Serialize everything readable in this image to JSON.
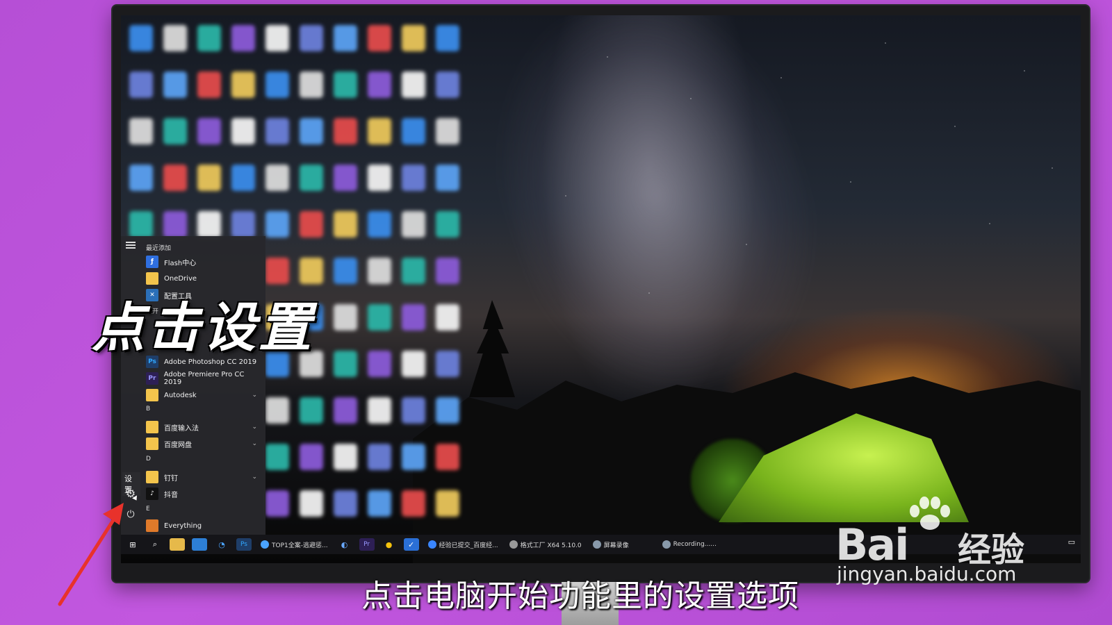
{
  "overlay": {
    "title": "点击设置",
    "subtitle": "点击电脑开始功能里的设置选项"
  },
  "watermark": {
    "brand": "Bai",
    "brand_cn": "经验",
    "url": "jingyan.baidu.com"
  },
  "start_menu": {
    "recent_header": "最近添加",
    "recent_items": [
      {
        "label": "Flash中心",
        "icon": "flash-icon",
        "color": "#2f6fe0"
      },
      {
        "label": "OneDrive",
        "icon": "folder-icon",
        "color": "#f3c44c"
      },
      {
        "label": "配置工具",
        "icon": "tools-icon",
        "color": "#2b6fb8"
      }
    ],
    "expand_label": "展开",
    "a_items": [
      {
        "label": "Adobe Photoshop CC 2019",
        "icon": "photoshop-icon",
        "badge": "Ps",
        "color": "#1f3e69"
      },
      {
        "label": "Adobe Premiere Pro CC 2019",
        "icon": "premiere-icon",
        "badge": "Pr",
        "color": "#2d1f55"
      },
      {
        "label": "Autodesk",
        "icon": "folder-icon",
        "color": "#f3c44c"
      }
    ],
    "letter_b": "B",
    "b_items": [
      {
        "label": "百度输入法",
        "icon": "folder-icon",
        "color": "#f3c44c"
      },
      {
        "label": "百度网盘",
        "icon": "folder-icon",
        "color": "#f3c44c"
      }
    ],
    "letter_d": "D",
    "d_items": [
      {
        "label": "钉钉",
        "icon": "folder-icon",
        "color": "#f3c44c"
      },
      {
        "label": "抖音",
        "icon": "tiktok-icon",
        "color": "#111111"
      }
    ],
    "letter_e": "E",
    "e_items": [
      {
        "label": "Everything",
        "icon": "everything-icon",
        "color": "#e07a2a"
      }
    ],
    "settings_tooltip": "设置"
  },
  "taskbar": {
    "apps": [
      {
        "label": "TOP1全案-逃避惩...",
        "color": "#4aa3ff"
      },
      {
        "label": "经验已提交_百度经...",
        "color": "#3a86ff"
      },
      {
        "label": "格式工厂 X64 5.10.0",
        "color": "#999999"
      },
      {
        "label": "屏幕录像",
        "color": "#8899aa"
      },
      {
        "label": "Recording......",
        "color": "#8899aa"
      }
    ]
  }
}
